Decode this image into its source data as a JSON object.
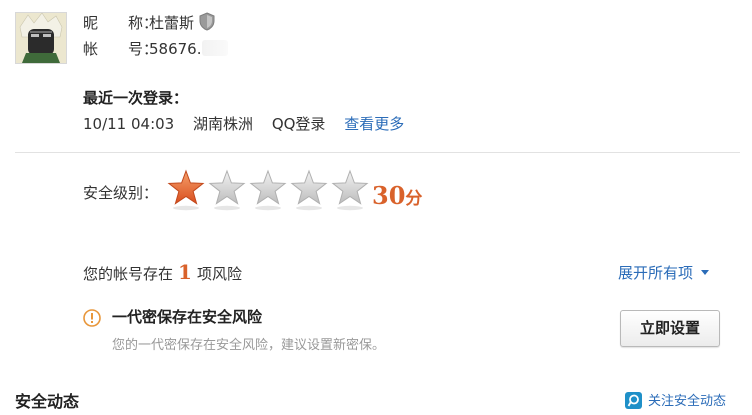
{
  "profile": {
    "nickname_label": "昵　　称：",
    "nickname": "杜蕾斯",
    "account_label": "帐　　号：",
    "account_number": "58676."
  },
  "last_login": {
    "title": "最近一次登录：",
    "time": "10/11  04:03",
    "location": "湖南株洲",
    "method": "QQ登录",
    "more_link": "查看更多"
  },
  "security": {
    "level_label": "安全级别：",
    "stars_total": 5,
    "stars_filled": 1,
    "score": "30",
    "score_unit": "分",
    "accent_color": "#d9622b"
  },
  "risk": {
    "prefix": "您的帐号存在",
    "count": "1",
    "suffix": "项风险",
    "expand_label": "展开所有项",
    "items": [
      {
        "title": "一代密保存在安全风险",
        "description": "您的一代密保存在安全风险，建议设置新密保。",
        "button": "立即设置",
        "icon": "warning-icon"
      }
    ]
  },
  "dynamics": {
    "title": "安全动态",
    "follow_label": "关注安全动态"
  },
  "colors": {
    "link": "#2b6cb8",
    "warning": "#e8963a"
  }
}
